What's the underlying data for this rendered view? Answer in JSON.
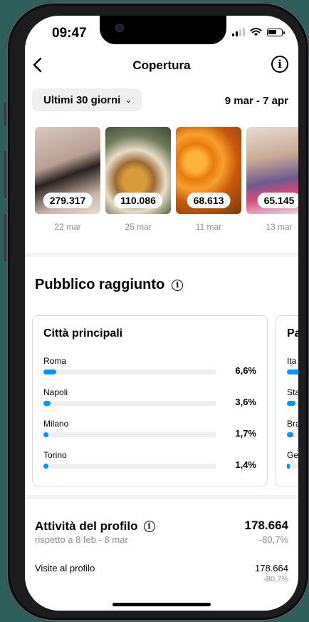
{
  "status_bar": {
    "time": "09:47"
  },
  "header": {
    "title": "Copertura"
  },
  "filter": {
    "range_label": "Ultimi 30 giorni",
    "date_range": "9 mar - 7 apr"
  },
  "reels": [
    {
      "count": "279.317",
      "date": "22 mar"
    },
    {
      "count": "110.086",
      "date": "25 mar"
    },
    {
      "count": "68.613",
      "date": "11 mar"
    },
    {
      "count": "65.145",
      "date": "13 mar"
    }
  ],
  "audience": {
    "title": "Pubblico raggiunto",
    "cities_card": {
      "title": "Città principali",
      "rows": [
        {
          "label": "Roma",
          "value": "6,6%",
          "share": 0.066
        },
        {
          "label": "Napoli",
          "value": "3,6%",
          "share": 0.036
        },
        {
          "label": "Milano",
          "value": "1,7%",
          "share": 0.017
        },
        {
          "label": "Torino",
          "value": "1,4%",
          "share": 0.014
        }
      ]
    },
    "countries_card": {
      "title": "Pa",
      "rows": [
        {
          "label": "Ita"
        },
        {
          "label": "Sta"
        },
        {
          "label": "Bra"
        },
        {
          "label": "Ge"
        }
      ]
    }
  },
  "activity": {
    "title": "Attività del profilo",
    "comparison": "rispetto a 8 feb - 8 mar",
    "total": "178.664",
    "delta": "-80,7%",
    "visits": {
      "label": "Visite al profilo",
      "value": "178.664",
      "delta": "-80,7%"
    }
  },
  "colors": {
    "accent": "#0095f6",
    "muted_text": "#8e8e8e",
    "track": "#eeeeee",
    "background": "#2f5f5a"
  }
}
